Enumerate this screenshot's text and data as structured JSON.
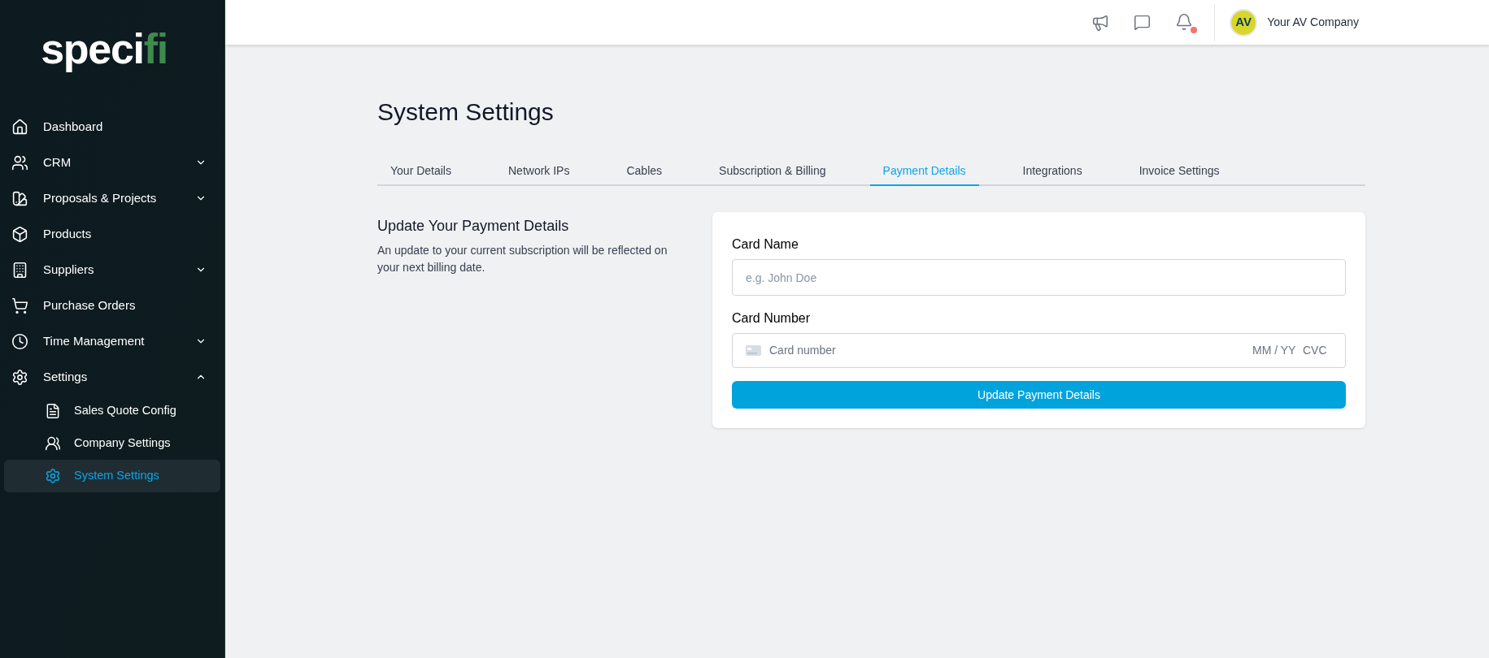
{
  "sidebar": {
    "logo": {
      "main": "speci",
      "accent": "fi"
    },
    "items": [
      {
        "label": "Dashboard"
      },
      {
        "label": "CRM",
        "expanded": false
      },
      {
        "label": "Proposals & Projects",
        "expanded": false
      },
      {
        "label": "Products"
      },
      {
        "label": "Suppliers",
        "expanded": false
      },
      {
        "label": "Purchase Orders"
      },
      {
        "label": "Time Management",
        "expanded": false
      },
      {
        "label": "Settings",
        "expanded": true,
        "children": [
          {
            "label": "Sales Quote Config",
            "selected": false
          },
          {
            "label": "Company Settings",
            "selected": false
          },
          {
            "label": "System Settings",
            "selected": true
          }
        ]
      }
    ]
  },
  "header": {
    "notifications_unread": true,
    "avatar": "AV",
    "company": "Your AV Company"
  },
  "page": {
    "title": "System Settings",
    "tabs": [
      {
        "label": "Your Details",
        "selected": false
      },
      {
        "label": "Network IPs",
        "selected": false
      },
      {
        "label": "Cables",
        "selected": false
      },
      {
        "label": "Subscription & Billing",
        "selected": false
      },
      {
        "label": "Payment Details",
        "selected": true
      },
      {
        "label": "Integrations",
        "selected": false
      },
      {
        "label": "Invoice Settings",
        "selected": false
      }
    ],
    "section": {
      "title": "Update Your Payment Details",
      "description": "An update to your current subscription will be reflected on your next billing date."
    },
    "form": {
      "card_name": {
        "label": "Card Name",
        "placeholder": "e.g. John Doe"
      },
      "card_number": {
        "label": "Card Number",
        "placeholder": "Card number",
        "expiry_placeholder": "MM / YY",
        "cvc_placeholder": "CVC"
      },
      "submit": "Update Payment Details"
    }
  }
}
